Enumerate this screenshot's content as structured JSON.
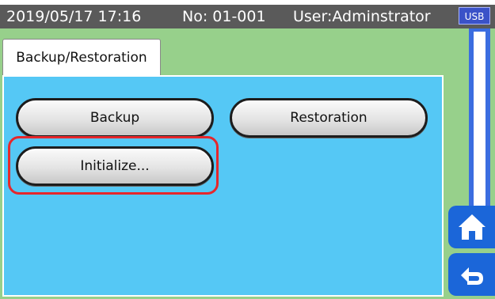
{
  "status": {
    "datetime": "2019/05/17 17:16",
    "number": "No: 01-001",
    "user": "User:Adminstrator",
    "usb_label": "USB"
  },
  "tab": {
    "label": "Backup/Restoration"
  },
  "buttons": {
    "backup": "Backup",
    "restoration": "Restoration",
    "initialize": "Initialize..."
  },
  "icons": {
    "home": "home-icon",
    "return": "return-icon"
  },
  "colors": {
    "status_bar": "#5a5a5a",
    "workspace": "#97d08b",
    "panel": "#55c8f5",
    "highlight": "#e5272c",
    "nav_button": "#1b66d9"
  }
}
